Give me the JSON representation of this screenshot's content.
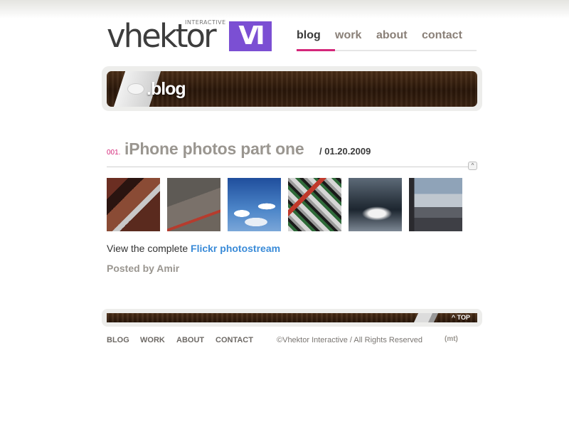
{
  "logo": {
    "word": "vhektor",
    "tag": "INTERACTIVE",
    "mark": "VI"
  },
  "nav": {
    "items": [
      {
        "label": "blog",
        "active": true
      },
      {
        "label": "work"
      },
      {
        "label": "about"
      },
      {
        "label": "contact"
      }
    ],
    "accent_color": "#d4277a"
  },
  "banner": {
    "title": ".blog"
  },
  "post": {
    "number": "001.",
    "title": "iPhone photos part one",
    "date_prefix": "/ ",
    "date": "01.20.2009",
    "thumbnails": [
      "photo-1",
      "photo-2",
      "photo-3",
      "photo-4",
      "photo-5",
      "photo-6"
    ],
    "body_text": "View the complete ",
    "body_link": "Flickr photostream",
    "posted_by": "Posted by Amir"
  },
  "footer": {
    "top_link": "^ TOP",
    "nav": [
      "BLOG",
      "WORK",
      "ABOUT",
      "CONTACT"
    ],
    "copyright": "©Vhektor Interactive / All Rights Reserved",
    "badge": "(mt)"
  },
  "colors": {
    "brand": "#7b4fd3",
    "link": "#3a8bd8",
    "wood": "#3a2211"
  }
}
